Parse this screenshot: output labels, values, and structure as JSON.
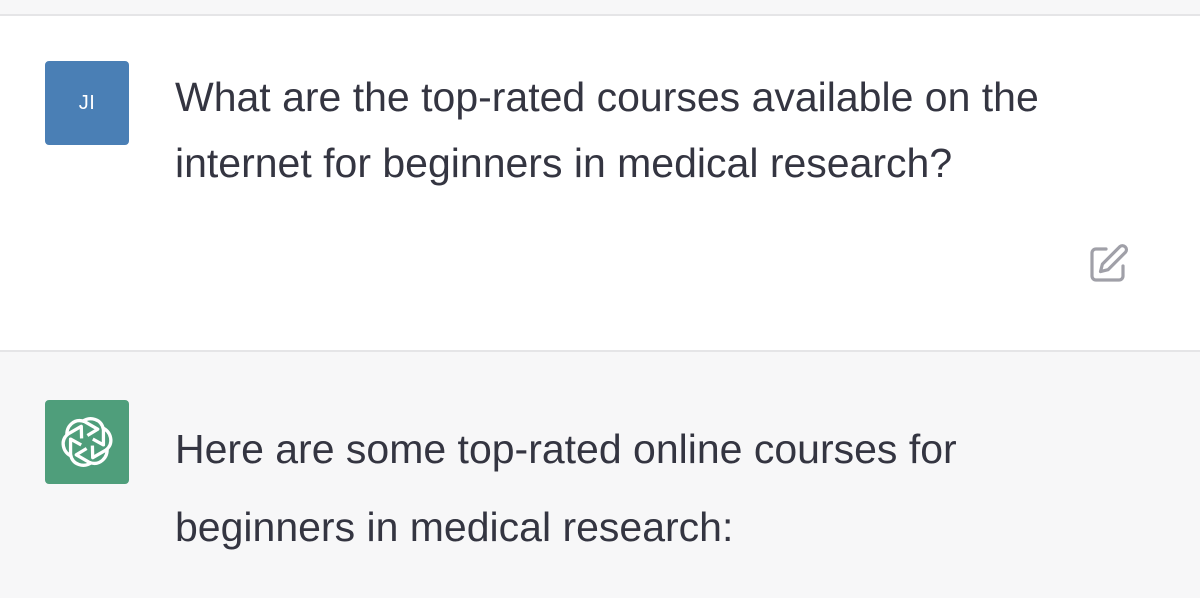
{
  "conversation": {
    "user_message": {
      "avatar_initials": "JI",
      "avatar_color": "#4a7fb5",
      "text": "What are the top-rated courses available on the internet for beginners in medical research?",
      "edit_icon": "edit-icon"
    },
    "assistant_message": {
      "avatar_icon": "openai-logo-icon",
      "avatar_color": "#4f9e7b",
      "text": "Here are some top-rated online courses for beginners in medical research:"
    }
  }
}
